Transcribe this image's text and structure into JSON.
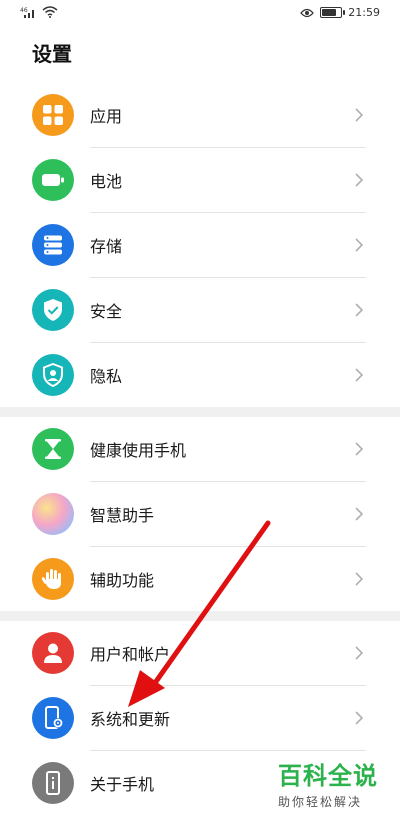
{
  "status_bar": {
    "time": "21:59",
    "battery_level": 0.8
  },
  "title": "设置",
  "groups": [
    {
      "items": [
        {
          "label": "应用",
          "icon": "apps-icon",
          "color": "#f59a1b"
        },
        {
          "label": "电池",
          "icon": "battery-icon",
          "color": "#2fbf5a"
        },
        {
          "label": "存储",
          "icon": "storage-icon",
          "color": "#1e74e3"
        },
        {
          "label": "安全",
          "icon": "shield-check-icon",
          "color": "#16b5b8"
        },
        {
          "label": "隐私",
          "icon": "privacy-shield-icon",
          "color": "#16b5b8"
        }
      ]
    },
    {
      "items": [
        {
          "label": "健康使用手机",
          "icon": "hourglass-icon",
          "color": "#2fbf5a"
        },
        {
          "label": "智慧助手",
          "icon": "assistant-orb-icon",
          "color": "#e89bd0"
        },
        {
          "label": "辅助功能",
          "icon": "hand-icon",
          "color": "#f59a1b"
        }
      ]
    },
    {
      "items": [
        {
          "label": "用户和帐户",
          "icon": "user-icon",
          "color": "#e53935"
        },
        {
          "label": "系统和更新",
          "icon": "phone-settings-icon",
          "color": "#1e74e3"
        },
        {
          "label": "关于手机",
          "icon": "phone-info-icon",
          "color": "#7a7a7a"
        }
      ]
    }
  ],
  "watermark": {
    "main": "百科全说",
    "sub": "助你轻松解决"
  }
}
